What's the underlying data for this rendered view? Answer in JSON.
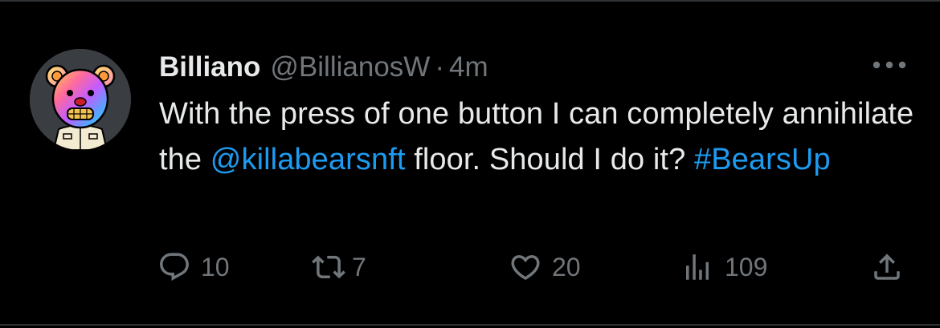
{
  "tweet": {
    "display_name": "Billiano",
    "handle": "@BillianosW",
    "separator": "·",
    "time": "4m",
    "text_parts": {
      "intro": "With the press of one button I can completely annihilate the ",
      "mention": "@killabearsnft",
      "middle": " floor. Should I do it? ",
      "hashtag": "#BearsUp"
    },
    "avatar_icon": "bear-avatar-icon",
    "more_icon": "more-dots-icon"
  },
  "actions": {
    "reply": {
      "icon": "reply-icon",
      "count": "10"
    },
    "retweet": {
      "icon": "retweet-icon",
      "count": "7"
    },
    "like": {
      "icon": "heart-icon",
      "count": "20"
    },
    "views": {
      "icon": "views-icon",
      "count": "109"
    },
    "share": {
      "icon": "share-icon"
    }
  },
  "colors": {
    "background": "#000000",
    "text": "#e7e9ea",
    "secondary": "#71767b",
    "link": "#1d9bf0",
    "border": "#2f3336"
  }
}
